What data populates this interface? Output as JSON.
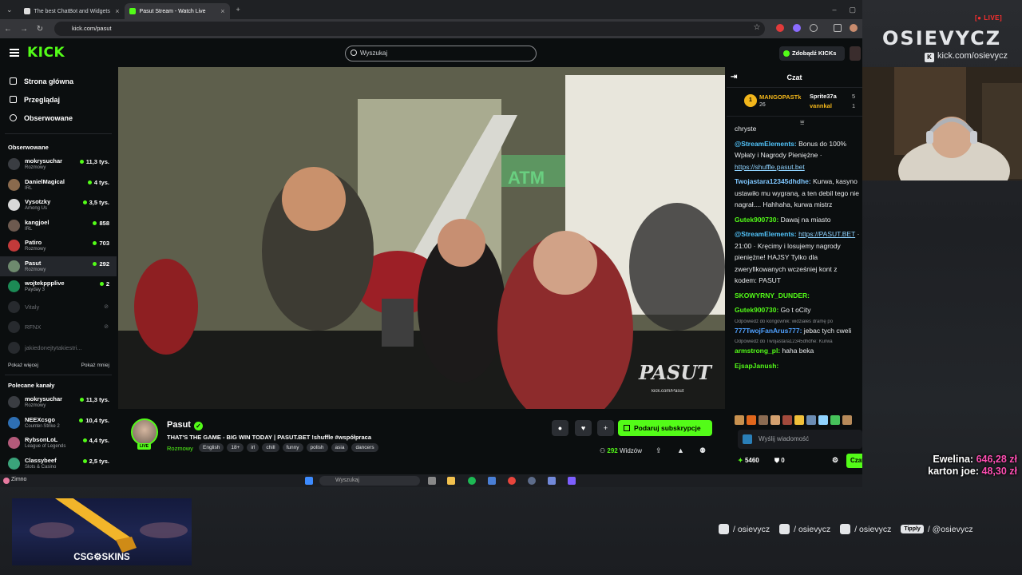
{
  "browser": {
    "tabs": [
      {
        "label": "The best ChatBot and Widgets"
      },
      {
        "label": "Pasut Stream - Watch Live"
      }
    ],
    "url": "kick.com/pasut"
  },
  "kick": {
    "logo": "KICK",
    "search_placeholder": "Wyszukaj",
    "get_kicks": "Zdobądź KICKs",
    "nav": [
      {
        "label": "Strona główna",
        "icon": "home-icon"
      },
      {
        "label": "Przeglądaj",
        "icon": "browse-icon"
      },
      {
        "label": "Obserwowane",
        "icon": "heart-icon"
      }
    ],
    "followed_heading": "Obserwowane",
    "followed": [
      {
        "name": "mokrysuchar",
        "category": "Rozmowy",
        "viewers": "11,3 tys."
      },
      {
        "name": "DanielMagical",
        "category": "IRL",
        "viewers": "4 tys."
      },
      {
        "name": "Vysotzky",
        "category": "Among Us",
        "viewers": "3,5 tys."
      },
      {
        "name": "kangjoel",
        "category": "IRL",
        "viewers": "858"
      },
      {
        "name": "Patiro",
        "category": "Rozmowy",
        "viewers": "703"
      },
      {
        "name": "Pasut",
        "category": "Rozmowy",
        "viewers": "292"
      },
      {
        "name": "wojtekppplive",
        "category": "Payday 3",
        "viewers": "2"
      }
    ],
    "offline": [
      {
        "name": "Vitaly"
      },
      {
        "name": "RFNX"
      },
      {
        "name": "jakiedonejtytakiestri..."
      }
    ],
    "show_more": "Pokaż więcej",
    "show_less": "Pokaż mniej",
    "recommended_heading": "Polecane kanały",
    "recommended": [
      {
        "name": "mokrysuchar",
        "category": "Rozmowy",
        "viewers": "11,3 tys."
      },
      {
        "name": "NEEXcsgo",
        "category": "Counter-Strike 2",
        "viewers": "10,4 tys."
      },
      {
        "name": "RybsonLoL",
        "category": "League of Legends",
        "viewers": "4,4 tys."
      },
      {
        "name": "Classybeef",
        "category": "Slots & Casino",
        "viewers": "2,5 tys."
      }
    ]
  },
  "video": {
    "watermark": "PASUT",
    "watermark_link": "kick.com/Pasut",
    "neon_sign": "ATM"
  },
  "stream": {
    "name": "Pasut",
    "live": "LIVE",
    "title": "THAT'S THE GAME - BIG WIN TODAY | PASUT.BET !shuffle #współpraca",
    "category": "Rozmowy",
    "tags": [
      "English",
      "18+",
      "irl",
      "chill",
      "funny",
      "polish",
      "asia",
      "dancers"
    ],
    "subscribe_label": "Podaruj subskrypcje",
    "viewers": "292",
    "viewers_label": "Widzów"
  },
  "chat": {
    "heading": "Czat",
    "pinned": [
      {
        "user": "MANGOPASTk",
        "count": "26"
      },
      {
        "user": "Sprite37a",
        "count": "5"
      },
      {
        "user": "vannkal",
        "count": "1"
      }
    ],
    "messages": [
      {
        "user": "",
        "text": "chryste",
        "color": "#e9ebed"
      },
      {
        "user": "@StreamElements:",
        "text": " Bonus do 100% Wpłaty i Nagrody Pieniężne · ",
        "link": "https://shuffle.pasut.bet",
        "color": "#53c7ff"
      },
      {
        "user": "Twojastara12345dhdhe:",
        "text": " Kurwa, kasyno ustawiło mu wygraną, a ten debil tego nie nagrał.... Hahhaha, kurwa mistrz",
        "color": "#7fc7ff"
      },
      {
        "user": "Gutek900730:",
        "text": " Dawaj na miasto",
        "color": "#53fc18"
      },
      {
        "user": "@StreamElements:",
        "text": " · 21:00 · Kręcimy i losujemy nagrody pieniężne! HAJSY Tylko dla zweryfikowanych wcześniej kont z kodem: PASUT",
        "link": "https://PASUT.BET",
        "color": "#53c7ff"
      },
      {
        "user": "SKOWYRNY_DUNDER:",
        "text": "",
        "color": "#53fc18"
      },
      {
        "user": "Gutek900730:",
        "text": " Go t oCity",
        "color": "#53fc18"
      },
      {
        "reply": "Odpowiedź do kongownik: widziałeś dramę po",
        "user": "777TwojFanArus777:",
        "text": " jebac tych cweli",
        "color": "#4fa0ff"
      },
      {
        "reply": "Odpowiedź do Twojastara12345dhdhe: Kurwa",
        "user": "armstrong_pl:",
        "text": " haha beka",
        "color": "#53fc18"
      },
      {
        "user": "EjsapJanush:",
        "text": "",
        "color": "#53fc18"
      }
    ],
    "input_placeholder": "Wyślij wiadomość",
    "kicks": "5460",
    "badges": "0",
    "send": "Czat"
  },
  "taskbar": {
    "weather": "Zimno",
    "search": "Wyszukaj"
  },
  "overlay": {
    "live": "LIVE",
    "brand": "OSIEVYCZ",
    "kick_handle": "kick.com/osievycz",
    "donations": [
      {
        "name": "Ewelina:",
        "amount": "646,28 zł"
      },
      {
        "name": "karton joe:",
        "amount": "48,30 zł"
      }
    ],
    "socials": [
      {
        "label": "/ osievycz",
        "icon": "instagram-icon"
      },
      {
        "label": "/ osievycz",
        "icon": "tiktok-icon"
      },
      {
        "label": "/ osievycz",
        "icon": "youtube-icon"
      },
      {
        "label": "/ @osievycz",
        "icon": "tipply-icon",
        "badge": "Tipply"
      }
    ],
    "sponsor": "CSG⚙SKINS"
  }
}
